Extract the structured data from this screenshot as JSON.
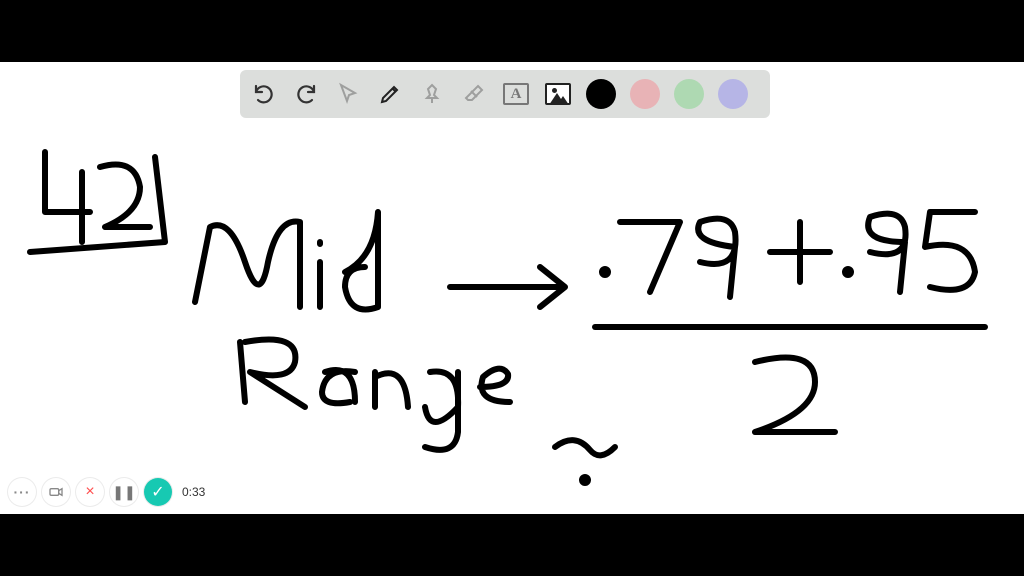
{
  "toolbar": {
    "tools": {
      "undo": "undo",
      "redo": "redo",
      "pointer": "pointer",
      "pencil": "pencil",
      "pin": "pin",
      "eraser": "eraser",
      "text": "A",
      "image": "image"
    },
    "colors": {
      "black": "#000000",
      "pink": "#e8b3b6",
      "green": "#aed9b2",
      "purple": "#b6b5e6"
    }
  },
  "handwriting": {
    "problem_number": "42)",
    "label_line1": "Mid",
    "label_line2": "Range",
    "arrow": "→",
    "numerator": ".79 + .95",
    "denominator": "2",
    "extra_mark": "~"
  },
  "controls": {
    "more": "···",
    "camera": "camera",
    "close": "×",
    "pause": "❚❚",
    "confirm": "✓",
    "timer": "0:33"
  }
}
